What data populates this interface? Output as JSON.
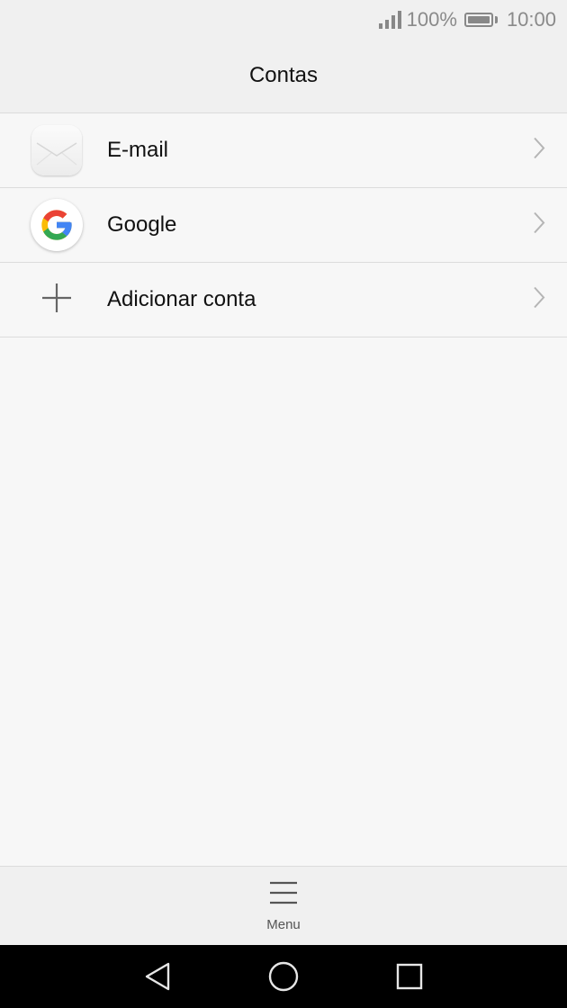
{
  "status_bar": {
    "battery_percent": "100%",
    "time": "10:00",
    "icons": [
      "signal-icon",
      "battery-icon"
    ]
  },
  "header": {
    "title": "Contas"
  },
  "accounts": [
    {
      "label": "E-mail",
      "icon": "mail-icon"
    },
    {
      "label": "Google",
      "icon": "google-icon"
    },
    {
      "label": "Adicionar conta",
      "icon": "plus-icon"
    }
  ],
  "bottom_bar": {
    "menu_label": "Menu",
    "menu_icon": "hamburger-icon"
  },
  "nav_bar": {
    "icons": [
      "back-icon",
      "home-icon",
      "recents-icon"
    ]
  },
  "colors": {
    "google_blue": "#4285F4",
    "google_red": "#EA4335",
    "google_yellow": "#FBBC05",
    "google_green": "#34A853"
  }
}
